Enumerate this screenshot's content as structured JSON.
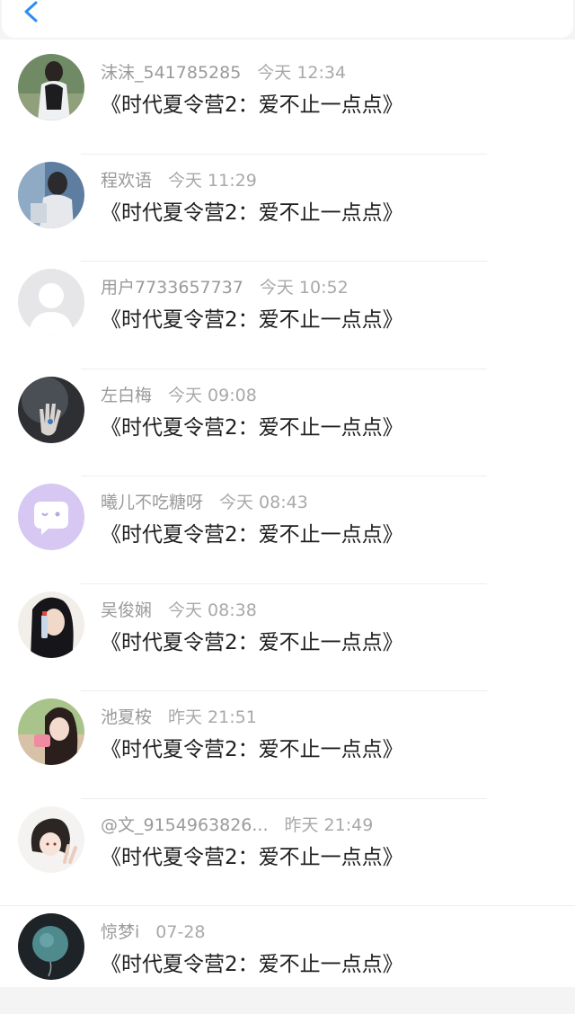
{
  "header": {
    "back_icon": "chevron-left-icon"
  },
  "comments": [
    {
      "user": "沫沫_541785285",
      "time": "今天 12:34",
      "text": "《时代夏令营2：爱不止一点点》",
      "avatar": "photo-girl-field"
    },
    {
      "user": "程欢语",
      "time": "今天 11:29",
      "text": "《时代夏令营2：爱不止一点点》",
      "avatar": "photo-girl-window"
    },
    {
      "user": "用户7733657737",
      "time": "今天 10:52",
      "text": "《时代夏令营2：爱不止一点点》",
      "avatar": "default-avatar"
    },
    {
      "user": "左白梅",
      "time": "今天 09:08",
      "text": "《时代夏令营2：爱不止一点点》",
      "avatar": "hand-eye"
    },
    {
      "user": "曦儿不吃糖呀",
      "time": "今天 08:43",
      "text": "《时代夏令营2：爱不止一点点》",
      "avatar": "purple-chat-bubble"
    },
    {
      "user": "吴俊娴",
      "time": "今天 08:38",
      "text": "《时代夏令营2：爱不止一点点》",
      "avatar": "photo-girl-bottle"
    },
    {
      "user": "池夏桉",
      "time": "昨天 21:51",
      "text": "《时代夏令营2：爱不止一点点》",
      "avatar": "photo-girl-drink"
    },
    {
      "user": "@文_9154963826...",
      "time": "昨天 21:49",
      "text": "《时代夏令营2：爱不止一点点》",
      "avatar": "anime-boy-peace"
    },
    {
      "user": "惊梦i",
      "time": "07-28",
      "text": "《时代夏令营2：爱不止一点点》",
      "avatar": "teal-balloon"
    }
  ]
}
